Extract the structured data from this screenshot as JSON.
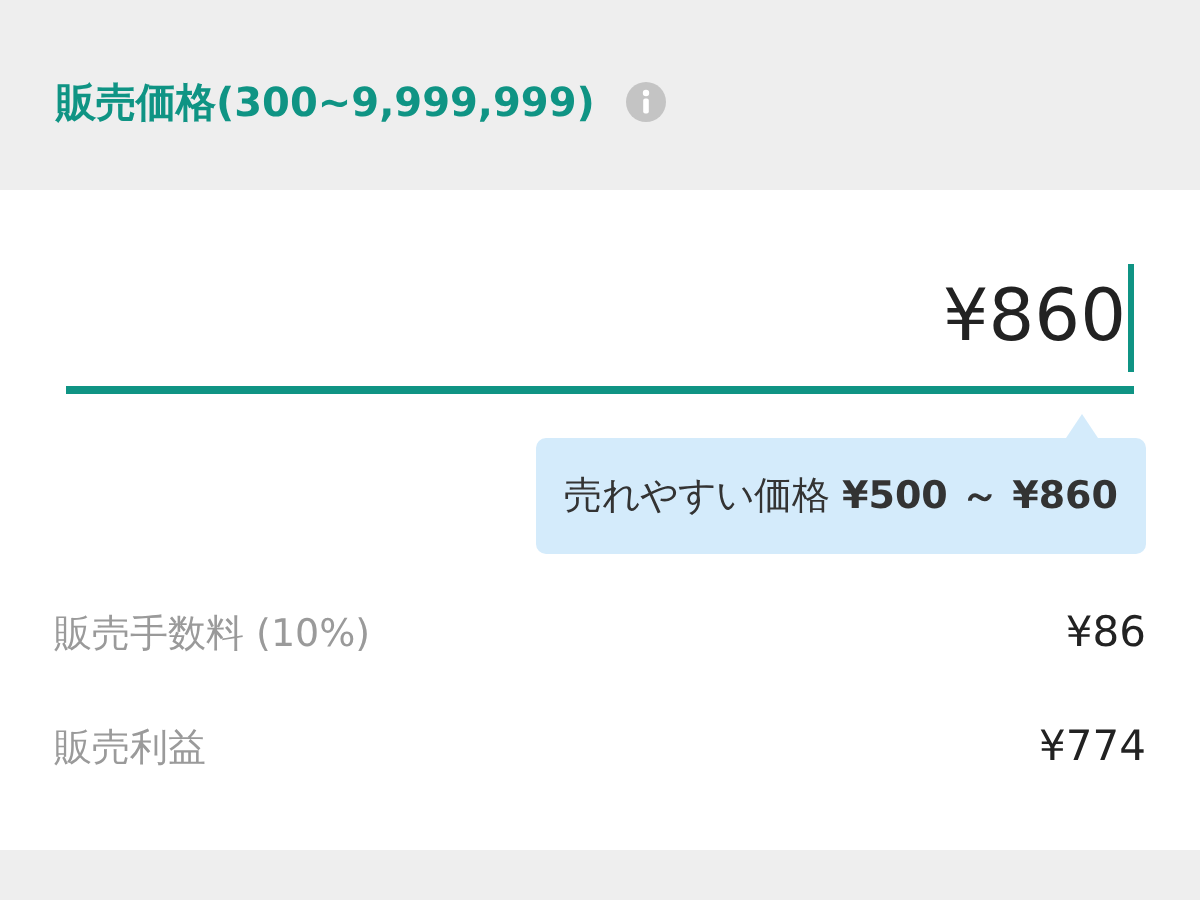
{
  "section": {
    "title": "販売価格(300~9,999,999)"
  },
  "price_field": {
    "value": "¥860",
    "focused": true
  },
  "tooltip": {
    "text": "売れやすい価格 **¥500 ～ ¥860**"
  },
  "summary": [
    {
      "label": "販売手数料 (10%)",
      "value": "¥86"
    },
    {
      "label": "販売利益",
      "value": "¥774"
    }
  ]
}
